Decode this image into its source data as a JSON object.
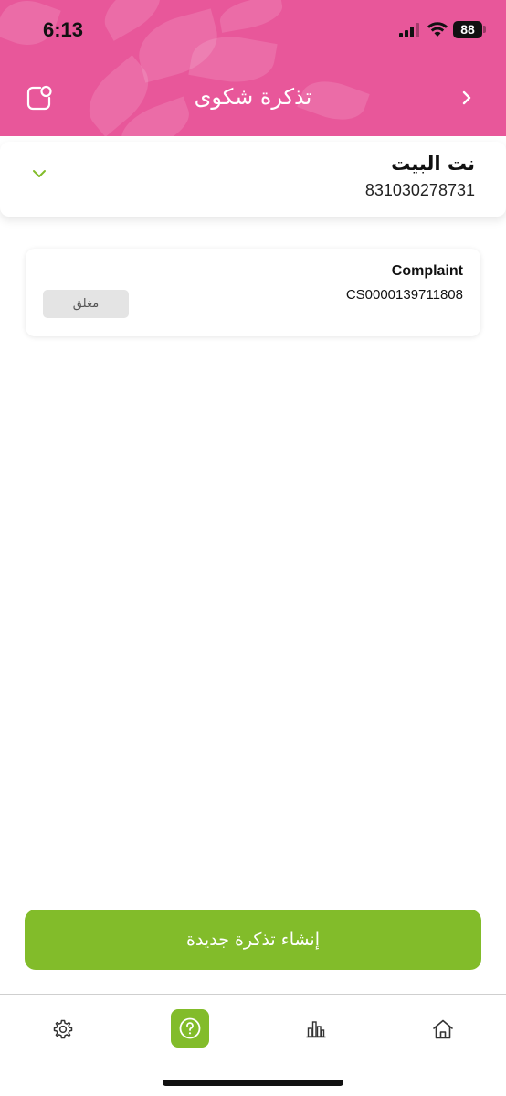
{
  "status_bar": {
    "time": "6:13",
    "battery": "88"
  },
  "header": {
    "title": "تذكرة شكوى",
    "background_color": "#e8579a",
    "left_icon": "chat-support-icon",
    "right_icon": "chevron-right-icon"
  },
  "account": {
    "name": "نت البيت",
    "number": "831030278731",
    "toggle_icon": "chevron-down-icon"
  },
  "tickets": [
    {
      "type": "Complaint",
      "id": "CS0000139711808",
      "status": "مغلق"
    }
  ],
  "create_button": {
    "label": "إنشاء تذكرة جديدة",
    "color": "#82bc2a"
  },
  "bottom_nav": {
    "items": [
      {
        "icon": "gear-icon"
      },
      {
        "icon": "help-icon",
        "active": true
      },
      {
        "icon": "bar-chart-icon"
      },
      {
        "icon": "home-icon"
      }
    ]
  }
}
